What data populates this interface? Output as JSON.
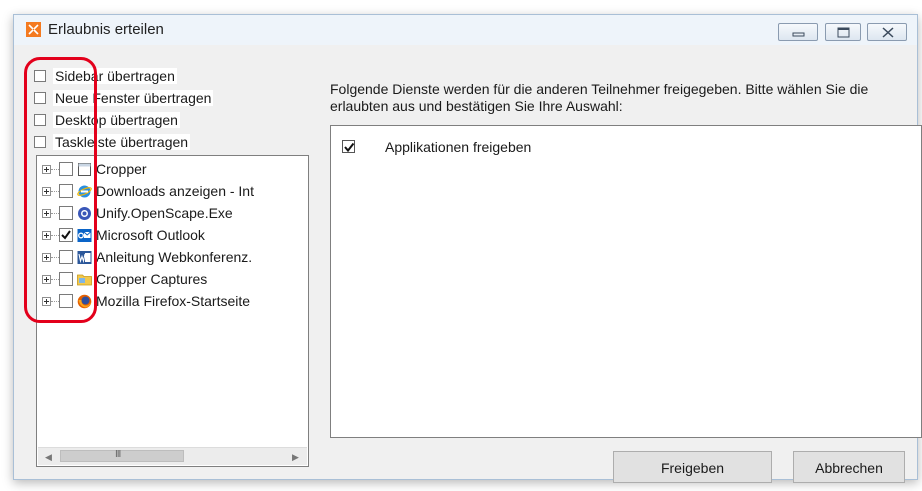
{
  "window": {
    "title": "Erlaubnis erteilen",
    "icon": "cropper-app-icon",
    "controls": [
      "minimize",
      "maximize",
      "close"
    ]
  },
  "left_options": [
    {
      "label": "Sidebar übertragen",
      "checked": false
    },
    {
      "label": "Neue Fenster übertragen",
      "checked": false
    },
    {
      "label": "Desktop übertragen",
      "checked": false
    },
    {
      "label": "Taskleiste übertragen",
      "checked": false
    }
  ],
  "tree": {
    "items": [
      {
        "label": "Cropper",
        "checked": false,
        "icon": "cropper-window-icon"
      },
      {
        "label": "Downloads anzeigen - Int",
        "checked": false,
        "icon": "internet-explorer-icon"
      },
      {
        "label": "Unify.OpenScape.Exe",
        "checked": false,
        "icon": "unify-openscape-icon"
      },
      {
        "label": "Microsoft Outlook",
        "checked": true,
        "icon": "outlook-icon"
      },
      {
        "label": "Anleitung Webkonferenz.",
        "checked": false,
        "icon": "word-icon"
      },
      {
        "label": "Cropper Captures",
        "checked": false,
        "icon": "folder-icon"
      },
      {
        "label": "Mozilla Firefox-Startseite",
        "checked": false,
        "icon": "firefox-icon"
      }
    ],
    "scrollbar": {
      "grip": "III"
    }
  },
  "right": {
    "description": "Folgende Dienste werden für die anderen Teilnehmer freigegeben. Bitte wählen Sie die erlaubten aus und bestätigen Sie Ihre Auswahl:",
    "services": [
      {
        "label": "Applikationen freigeben",
        "checked": true
      }
    ]
  },
  "buttons": {
    "share": "Freigeben",
    "cancel": "Abbrechen"
  },
  "colors": {
    "highlight": "#e3001b",
    "titlebar": "#eef4fa",
    "dialog_bg": "#f0f0f0"
  }
}
